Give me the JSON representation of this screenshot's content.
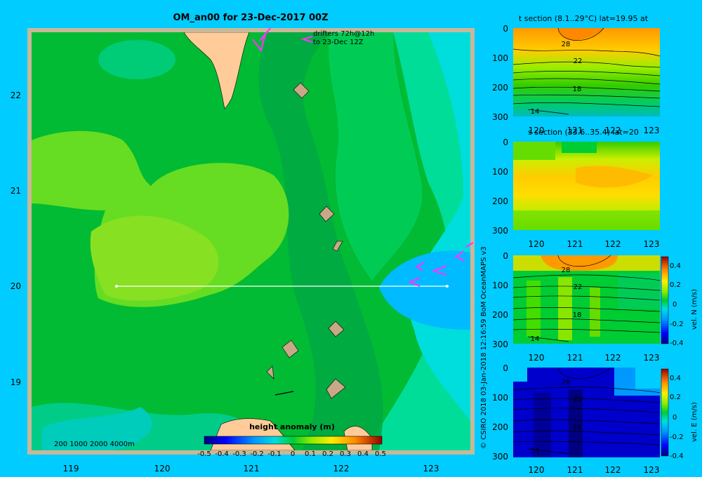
{
  "title": "OM_an00 for 23-Dec-2017 00Z",
  "drifters": {
    "line1": "drifters 72h@12h",
    "line2": "to 23-Dec 12Z"
  },
  "map": {
    "x_ticks": [
      "119",
      "120",
      "121",
      "122",
      "123"
    ],
    "y_ticks": [
      "22",
      "21",
      "20",
      "19"
    ],
    "depth_legend": "200  1000  2000  4000m",
    "colorbar": {
      "title": "height anomaly (m)",
      "labels": [
        "-0.5",
        "-0.4",
        "-0.3",
        "-0.2",
        "-0.1",
        "0",
        "0.1",
        "0.2",
        "0.3",
        "0.4",
        "0.5"
      ]
    },
    "section_line": {
      "lon_start": 119.5,
      "lon_end": 123.2,
      "lat": 20
    }
  },
  "credit": "© CSIRO 2018   03-Jan-2018 12:16:59 BoM OceanMAPS v3",
  "panels": [
    {
      "title": "t section (8.1..29°C) lat=19.95 at",
      "y_ticks": [
        "0",
        "100",
        "200",
        "300"
      ],
      "x_ticks": [
        "120",
        "121",
        "122",
        "123"
      ],
      "contours": [
        "28",
        "22",
        "18",
        "14"
      ],
      "colorbar": null
    },
    {
      "title": "s section (33.6..35.4) lat=20",
      "y_ticks": [
        "0",
        "100",
        "200",
        "300"
      ],
      "x_ticks": [
        "120",
        "121",
        "122",
        "123"
      ],
      "contours": [],
      "colorbar": null
    },
    {
      "title": "",
      "y_ticks": [
        "0",
        "100",
        "200",
        "300"
      ],
      "x_ticks": [
        "120",
        "121",
        "122",
        "123"
      ],
      "contours": [
        "28",
        "22",
        "18",
        "14"
      ],
      "colorbar": {
        "label": "vel. N (m/s)",
        "ticks": [
          "0.4",
          "0.2",
          "0",
          "-0.2",
          "-0.4"
        ]
      }
    },
    {
      "title": "",
      "y_ticks": [
        "0",
        "100",
        "200",
        "300"
      ],
      "x_ticks": [
        "120",
        "121",
        "122",
        "123"
      ],
      "contours": [
        "28",
        "22",
        "18",
        "14"
      ],
      "colorbar": {
        "label": "vel. E (m/s)",
        "ticks": [
          "0.4",
          "0.2",
          "0",
          "-0.2",
          "-0.4"
        ]
      }
    }
  ],
  "colors": {
    "background": "#00ccff",
    "land": "#ffcc99",
    "drifter": "#ff33ff",
    "frame": "#c8b89a"
  }
}
